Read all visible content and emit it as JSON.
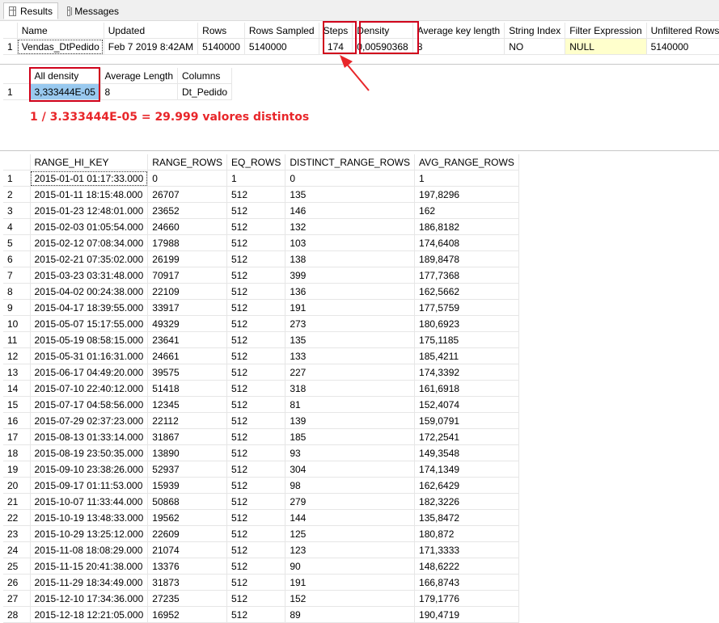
{
  "tabs": [
    {
      "label": "Results",
      "icon": "grid-icon",
      "active": true
    },
    {
      "label": "Messages",
      "icon": "messages-icon",
      "active": false
    }
  ],
  "stats_header": {
    "columns": [
      "Name",
      "Updated",
      "Rows",
      "Rows Sampled",
      "Steps",
      "Density",
      "Average key length",
      "String Index",
      "Filter Expression",
      "Unfiltered Rows"
    ],
    "row": {
      "num": "1",
      "cells": [
        "Vendas_DtPedido",
        "Feb  7 2019  8:42AM",
        "5140000",
        "5140000",
        "174",
        "0,00590368",
        "8",
        "NO",
        "NULL",
        "5140000"
      ]
    }
  },
  "density_vector": {
    "columns": [
      "All density",
      "Average Length",
      "Columns"
    ],
    "row": {
      "num": "1",
      "cells": [
        "3,333444E-05",
        "8",
        "Dt_Pedido"
      ]
    }
  },
  "annotation": {
    "text": "1 / 3.333444E-05 = 29.999 valores distintos",
    "color": "#e8262a"
  },
  "histogram": {
    "columns": [
      "RANGE_HI_KEY",
      "RANGE_ROWS",
      "EQ_ROWS",
      "DISTINCT_RANGE_ROWS",
      "AVG_RANGE_ROWS"
    ],
    "rows": [
      [
        "1",
        "2015-01-01 01:17:33.000",
        "0",
        "1",
        "0",
        "1"
      ],
      [
        "2",
        "2015-01-11 18:15:48.000",
        "26707",
        "512",
        "135",
        "197,8296"
      ],
      [
        "3",
        "2015-01-23 12:48:01.000",
        "23652",
        "512",
        "146",
        "162"
      ],
      [
        "4",
        "2015-02-03 01:05:54.000",
        "24660",
        "512",
        "132",
        "186,8182"
      ],
      [
        "5",
        "2015-02-12 07:08:34.000",
        "17988",
        "512",
        "103",
        "174,6408"
      ],
      [
        "6",
        "2015-02-21 07:35:02.000",
        "26199",
        "512",
        "138",
        "189,8478"
      ],
      [
        "7",
        "2015-03-23 03:31:48.000",
        "70917",
        "512",
        "399",
        "177,7368"
      ],
      [
        "8",
        "2015-04-02 00:24:38.000",
        "22109",
        "512",
        "136",
        "162,5662"
      ],
      [
        "9",
        "2015-04-17 18:39:55.000",
        "33917",
        "512",
        "191",
        "177,5759"
      ],
      [
        "10",
        "2015-05-07 15:17:55.000",
        "49329",
        "512",
        "273",
        "180,6923"
      ],
      [
        "11",
        "2015-05-19 08:58:15.000",
        "23641",
        "512",
        "135",
        "175,1185"
      ],
      [
        "12",
        "2015-05-31 01:16:31.000",
        "24661",
        "512",
        "133",
        "185,4211"
      ],
      [
        "13",
        "2015-06-17 04:49:20.000",
        "39575",
        "512",
        "227",
        "174,3392"
      ],
      [
        "14",
        "2015-07-10 22:40:12.000",
        "51418",
        "512",
        "318",
        "161,6918"
      ],
      [
        "15",
        "2015-07-17 04:58:56.000",
        "12345",
        "512",
        "81",
        "152,4074"
      ],
      [
        "16",
        "2015-07-29 02:37:23.000",
        "22112",
        "512",
        "139",
        "159,0791"
      ],
      [
        "17",
        "2015-08-13 01:33:14.000",
        "31867",
        "512",
        "185",
        "172,2541"
      ],
      [
        "18",
        "2015-08-19 23:50:35.000",
        "13890",
        "512",
        "93",
        "149,3548"
      ],
      [
        "19",
        "2015-09-10 23:38:26.000",
        "52937",
        "512",
        "304",
        "174,1349"
      ],
      [
        "20",
        "2015-09-17 01:11:53.000",
        "15939",
        "512",
        "98",
        "162,6429"
      ],
      [
        "21",
        "2015-10-07 11:33:44.000",
        "50868",
        "512",
        "279",
        "182,3226"
      ],
      [
        "22",
        "2015-10-19 13:48:33.000",
        "19562",
        "512",
        "144",
        "135,8472"
      ],
      [
        "23",
        "2015-10-29 13:25:12.000",
        "22609",
        "512",
        "125",
        "180,872"
      ],
      [
        "24",
        "2015-11-08 18:08:29.000",
        "21074",
        "512",
        "123",
        "171,3333"
      ],
      [
        "25",
        "2015-11-15 20:41:38.000",
        "13376",
        "512",
        "90",
        "148,6222"
      ],
      [
        "26",
        "2015-11-29 18:34:49.000",
        "31873",
        "512",
        "191",
        "166,8743"
      ],
      [
        "27",
        "2015-12-10 17:34:36.000",
        "27235",
        "512",
        "152",
        "179,1776"
      ],
      [
        "28",
        "2015-12-18 12:21:05.000",
        "16952",
        "512",
        "89",
        "190,4719"
      ]
    ]
  },
  "colors": {
    "highlight_red": "#d0021b",
    "selected_cell": "#99c9ef",
    "null_cell": "#ffffcc"
  }
}
